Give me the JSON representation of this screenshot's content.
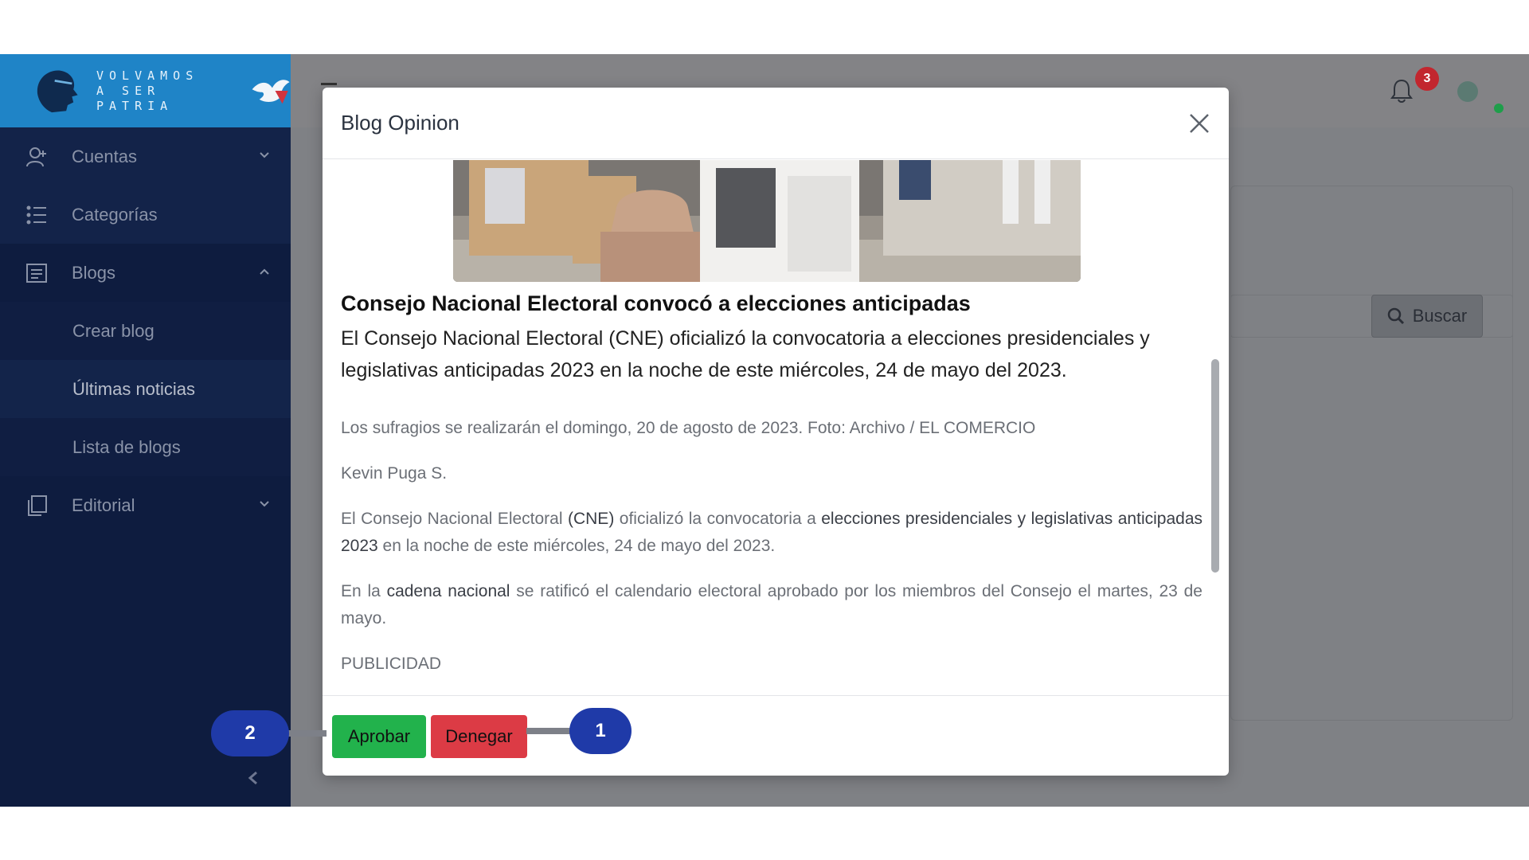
{
  "logo": {
    "line1": "VOLVAMOS",
    "line2": "A SER PATRIA"
  },
  "sidebar": {
    "items": [
      {
        "label": "Cuentas",
        "icon": "user-plus-icon"
      },
      {
        "label": "Categorías",
        "icon": "list-icon"
      },
      {
        "label": "Blogs",
        "icon": "document-icon"
      },
      {
        "label": "Editorial",
        "icon": "copy-icon"
      }
    ],
    "blog_sub": [
      {
        "label": "Crear blog"
      },
      {
        "label": "Últimas noticias"
      },
      {
        "label": "Lista de blogs"
      }
    ]
  },
  "header": {
    "notification_count": "3"
  },
  "search": {
    "button_label": "Buscar"
  },
  "modal": {
    "title": "Blog Opinion",
    "headline": "Consejo Nacional Electoral convocó a elecciones anticipadas",
    "lead": "El Consejo Nacional Electoral (CNE) oficializó la convocatoria a elecciones presidenciales y legislativas anticipadas 2023 en la noche de este miércoles, 24 de mayo del 2023.",
    "caption": "Los sufragios se realizarán el domingo, 20 de agosto de 2023. Foto: Archivo / EL COMERCIO",
    "author": "Kevin Puga S.",
    "p1_a": "El Consejo Nacional Electoral ",
    "p1_b": "(CNE)",
    "p1_c": " oficializó la convocatoria a ",
    "p1_d": "elecciones presidenciales y legislativas anticipadas 2023",
    "p1_e": " en la noche de este miércoles, 24 de mayo del 2023.",
    "p2_a": "En la ",
    "p2_b": "cadena nacional",
    "p2_c": " se ratificó el calendario electoral aprobado por los miembros del Consejo el martes, 23 de mayo.",
    "publicidad": "PUBLICIDAD",
    "approve_label": "Aprobar",
    "deny_label": "Denegar"
  },
  "callouts": {
    "one": "1",
    "two": "2"
  },
  "colors": {
    "sidebar": "#0e1c3f",
    "logo_bg": "#1f84c7",
    "approve": "#22b24c",
    "deny": "#dc3b45",
    "callout": "#1f3aa8",
    "badge": "#c2262e"
  }
}
